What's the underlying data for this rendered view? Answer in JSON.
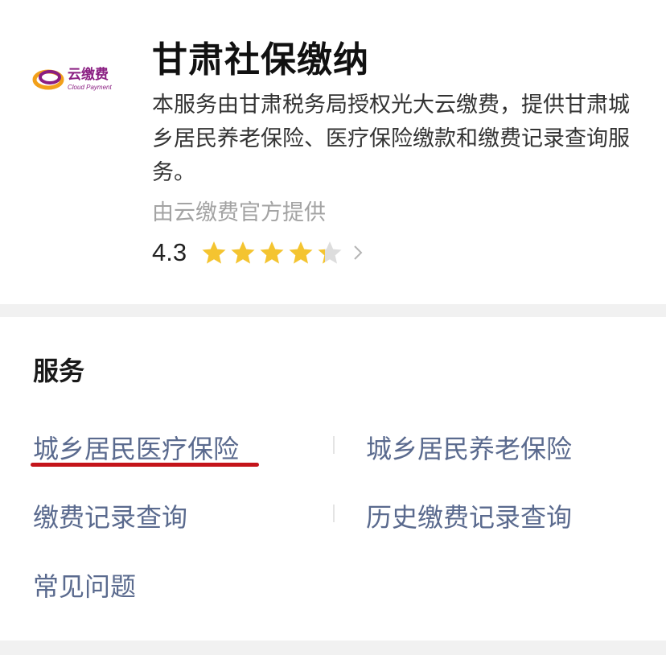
{
  "header": {
    "logo_text": "云缴费",
    "logo_subtext": "Cloud Payment",
    "title": "甘肃社保缴纳",
    "description": "本服务由甘肃税务局授权光大云缴费，提供甘肃城乡居民养老保险、医疗保险缴款和缴费记录查询服务。",
    "provider": "由云缴费官方提供",
    "rating": "4.3",
    "rating_value": 4.3,
    "rating_max": 5
  },
  "services": {
    "title": "服务",
    "items": [
      {
        "label": "城乡居民医疗保险"
      },
      {
        "label": "城乡居民养老保险"
      },
      {
        "label": "缴费记录查询"
      },
      {
        "label": "历史缴费记录查询"
      },
      {
        "label": "常见问题"
      }
    ]
  },
  "colors": {
    "star": "#f4c430",
    "star_empty": "#dddddd",
    "link": "#5a6a8e",
    "underline": "#c4141a",
    "logo_purple": "#8a1e82",
    "logo_orange": "#f2a01a"
  },
  "icons": [
    "logo-icon",
    "star-icon",
    "chevron-right-icon"
  ]
}
